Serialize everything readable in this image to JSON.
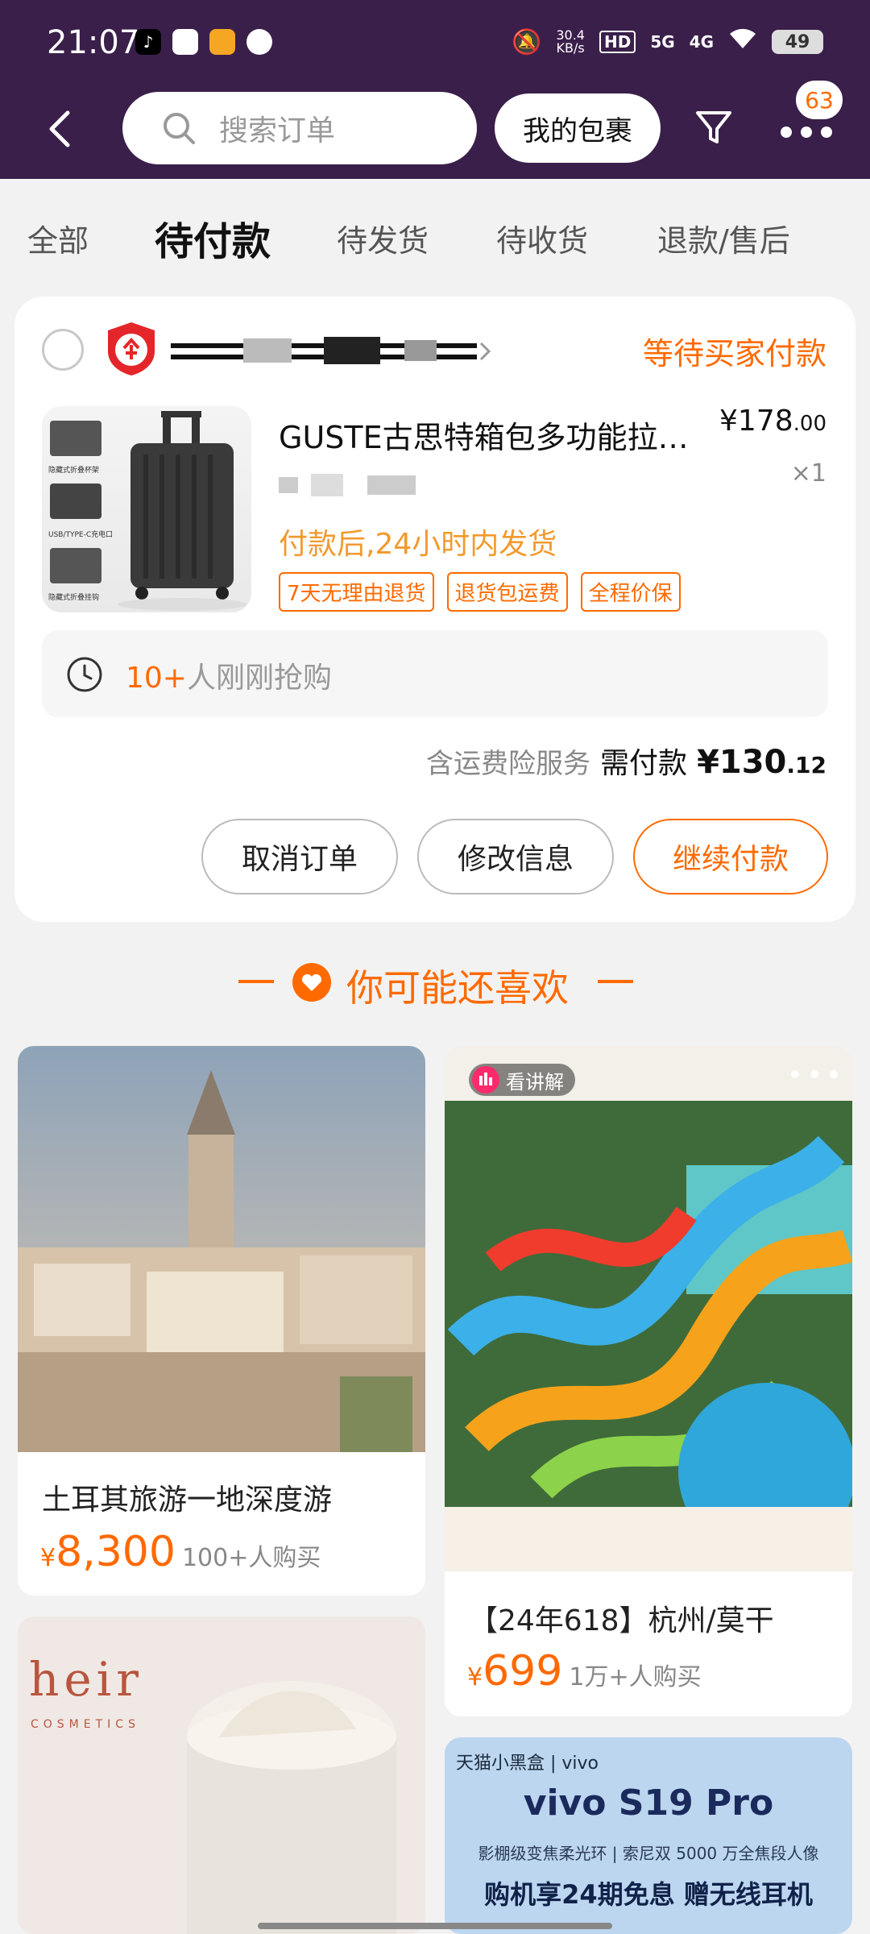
{
  "status_bar": {
    "time": "21:07",
    "net_speed": "30.4",
    "net_unit": "KB/s",
    "hd": "HD",
    "sig1": "5G",
    "sig2": "4G",
    "battery": "49"
  },
  "header": {
    "search_placeholder": "搜索订单",
    "packages_label": "我的包裹",
    "notification_count": "63"
  },
  "tabs": [
    {
      "label": "全部",
      "active": false
    },
    {
      "label": "待付款",
      "active": true
    },
    {
      "label": "待发货",
      "active": false
    },
    {
      "label": "待收货",
      "active": false
    },
    {
      "label": "退款/售后",
      "active": false
    }
  ],
  "order": {
    "status": "等待买家付款",
    "product_title": "GUSTE古思特箱包多功能拉…",
    "price_main": "¥178",
    "price_decimal": ".00",
    "quantity": "×1",
    "shipping_promise": "付款后,24小时内发货",
    "tags": [
      "7天无理由退货",
      "退货包运费",
      "全程价保"
    ],
    "thumb_labels": [
      "隐藏式折叠杯架",
      "USB/TYPE-C充电口",
      "隐藏式折叠挂钩"
    ],
    "rush_highlight": "10+",
    "rush_text": "人刚刚抢购",
    "pay_note": "含运费险服务",
    "pay_label": "需付款",
    "pay_amount_main": "¥130",
    "pay_amount_decimal": ".12",
    "buttons": {
      "cancel": "取消订单",
      "modify": "修改信息",
      "continue": "继续付款"
    }
  },
  "recommend": {
    "heading": "你可能还喜欢",
    "items": [
      {
        "title": "土耳其旅游一地深度游",
        "price": "8,300",
        "sales": "100+人购买"
      },
      {
        "title": "【24年618】杭州/莫干",
        "price": "699",
        "sales": "1万+人购买",
        "pill": "看讲解"
      },
      {
        "brand": "heir",
        "brand_sub": "COSMETICS"
      },
      {
        "brand_bar": "天猫小黑盒 | vivo",
        "model": "vivo S19 Pro",
        "subline": "影棚级变焦柔光环 | 索尼双 5000 万全焦段人像",
        "promo": "购机享24期免息 赠无线耳机"
      }
    ]
  },
  "colors": {
    "header_bg": "#3a1f4a",
    "accent": "#ff6a00",
    "ship_text": "#f29a2e"
  }
}
